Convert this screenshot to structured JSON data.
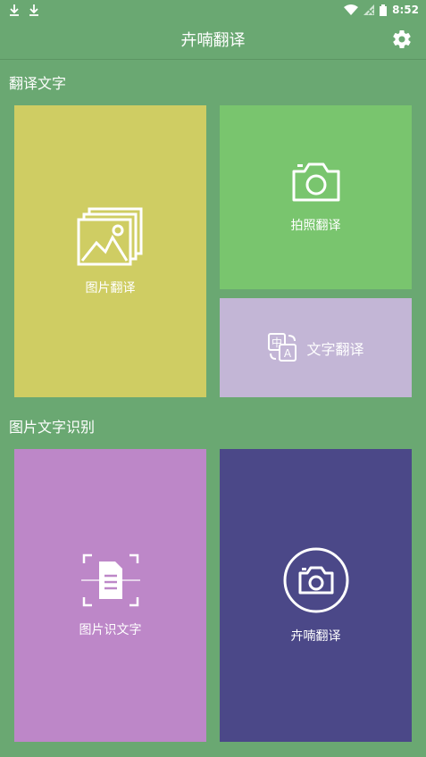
{
  "status_bar": {
    "time": "8:52",
    "left_icons": [
      "download-icon",
      "download-icon"
    ],
    "right_icons": [
      "wifi-icon",
      "signal-icon",
      "battery-icon"
    ]
  },
  "app_bar": {
    "title": "卉喃翻译",
    "settings_icon": "gear-icon"
  },
  "sections": [
    {
      "title": "翻译文字",
      "tiles": [
        {
          "label": "图片翻译",
          "icon": "image-gallery-icon",
          "color": "#cfcd63"
        },
        {
          "label": "拍照翻译",
          "icon": "camera-icon",
          "color": "#79c56e"
        },
        {
          "label": "文字翻译",
          "icon": "translate-icon",
          "color": "#c3b6d6"
        }
      ]
    },
    {
      "title": "图片文字识别",
      "tiles": [
        {
          "label": "图片识文字",
          "icon": "document-scan-icon",
          "color": "#bd87c8"
        },
        {
          "label": "卉喃翻译",
          "icon": "camera-circle-icon",
          "color": "#4b4888"
        }
      ]
    }
  ],
  "colors": {
    "background": "#6aa872",
    "text": "#ffffff"
  }
}
